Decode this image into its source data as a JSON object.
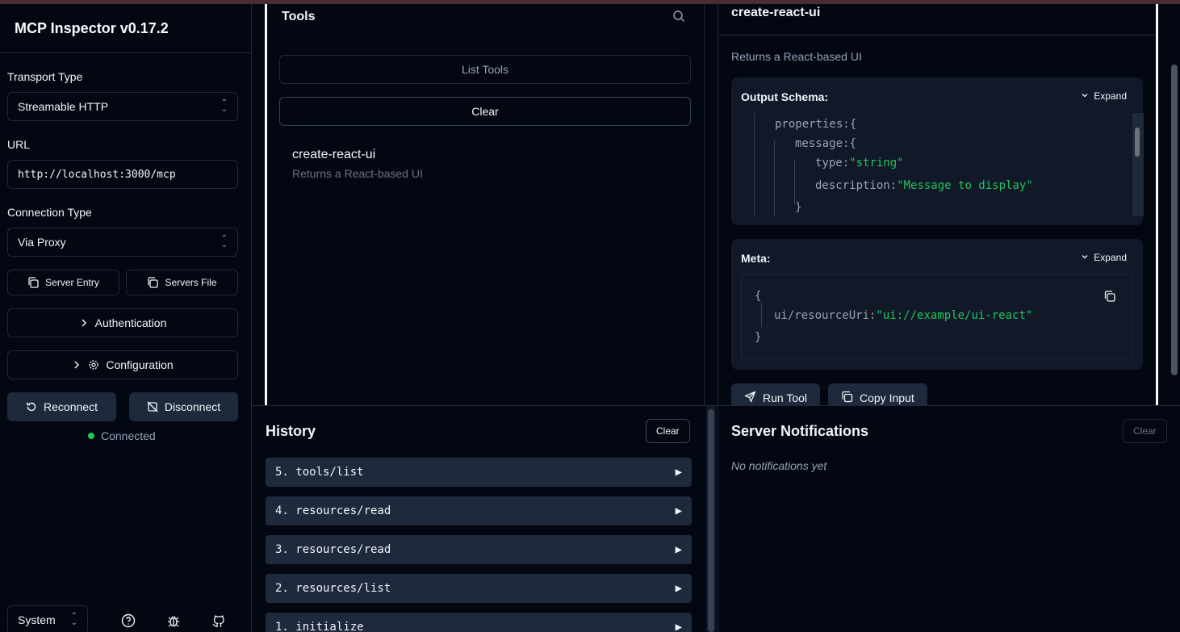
{
  "app": {
    "title": "MCP Inspector v0.17.2"
  },
  "sidebar": {
    "transport_label": "Transport Type",
    "transport_value": "Streamable HTTP",
    "url_label": "URL",
    "url_value": "http://localhost:3000/mcp",
    "connection_label": "Connection Type",
    "connection_value": "Via Proxy",
    "server_entry": "Server Entry",
    "servers_file": "Servers File",
    "authentication": "Authentication",
    "configuration": "Configuration",
    "reconnect": "Reconnect",
    "disconnect": "Disconnect",
    "status": "Connected",
    "theme": "System"
  },
  "tools": {
    "title": "Tools",
    "list_button": "List Tools",
    "clear_button": "Clear",
    "items": [
      {
        "name": "create-react-ui",
        "description": "Returns a React-based UI"
      }
    ]
  },
  "detail": {
    "title": "create-react-ui",
    "description": "Returns a React-based UI",
    "output_schema_label": "Output Schema:",
    "meta_label": "Meta:",
    "expand": "Expand",
    "schema_lines": {
      "properties": "properties:",
      "brace": "{",
      "message": "message:",
      "type_key": "type:",
      "type_val": "\"string\"",
      "desc_key": "description:",
      "desc_val": "\"Message to display\"",
      "close": "}"
    },
    "meta_lines": {
      "open": "{",
      "key": "ui/resourceUri:",
      "value": "\"ui://example/ui-react\"",
      "close": "}"
    },
    "run_tool": "Run Tool",
    "copy_input": "Copy Input"
  },
  "history": {
    "title": "History",
    "clear": "Clear",
    "items": [
      "5. tools/list",
      "4. resources/read",
      "3. resources/read",
      "2. resources/list",
      "1. initialize"
    ]
  },
  "notifications": {
    "title": "Server Notifications",
    "clear": "Clear",
    "empty": "No notifications yet"
  }
}
